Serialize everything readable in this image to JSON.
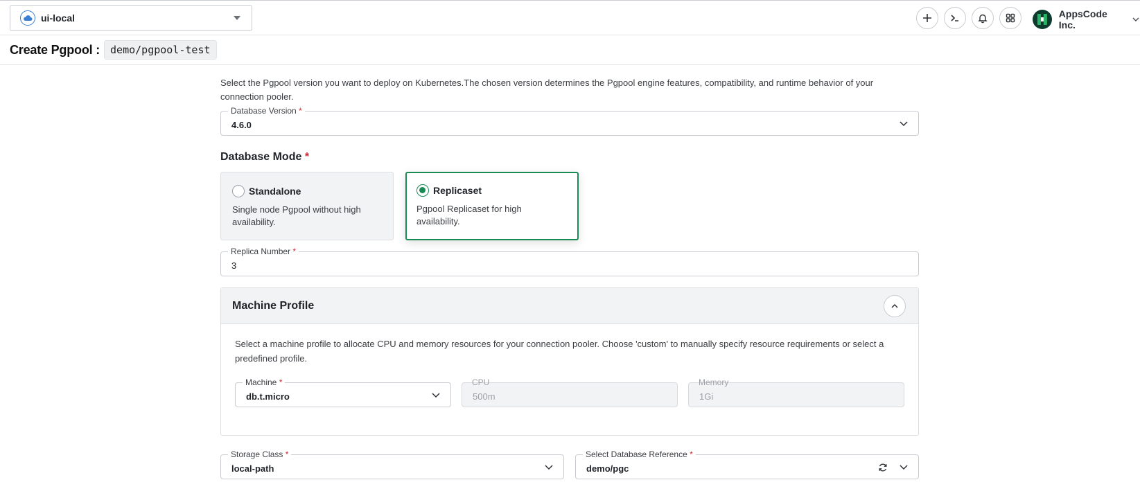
{
  "topbar": {
    "cluster_name": "ui-local",
    "org_name": "AppsCode Inc."
  },
  "page": {
    "title": "Create Pgpool :",
    "ref": "demo/pgpool-test"
  },
  "intro": "Select the Pgpool version you want to deploy on Kubernetes.The chosen version determines the Pgpool engine features, compatibility, and runtime behavior of your connection pooler.",
  "version": {
    "label": "Database Version",
    "value": "4.6.0"
  },
  "mode": {
    "title": "Database Mode",
    "options": [
      {
        "title": "Standalone",
        "desc": "Single node Pgpool without high availability.",
        "selected": false
      },
      {
        "title": "Replicaset",
        "desc": "Pgpool Replicaset for high availability.",
        "selected": true
      }
    ]
  },
  "replica": {
    "label": "Replica Number",
    "value": "3"
  },
  "machine_profile": {
    "title": "Machine Profile",
    "desc": "Select a machine profile to allocate CPU and memory resources for your connection pooler. Choose 'custom' to manually specify resource requirements or select a predefined profile.",
    "machine": {
      "label": "Machine",
      "value": "db.t.micro"
    },
    "cpu": {
      "label": "CPU",
      "value": "500m"
    },
    "memory": {
      "label": "Memory",
      "value": "1Gi"
    }
  },
  "storage_class": {
    "label": "Storage Class",
    "value": "local-path"
  },
  "db_reference": {
    "label": "Select Database Reference",
    "value": "demo/pgc"
  },
  "required_mark": "*",
  "colors": {
    "accent": "#1a8a55",
    "required": "#d1242f"
  }
}
